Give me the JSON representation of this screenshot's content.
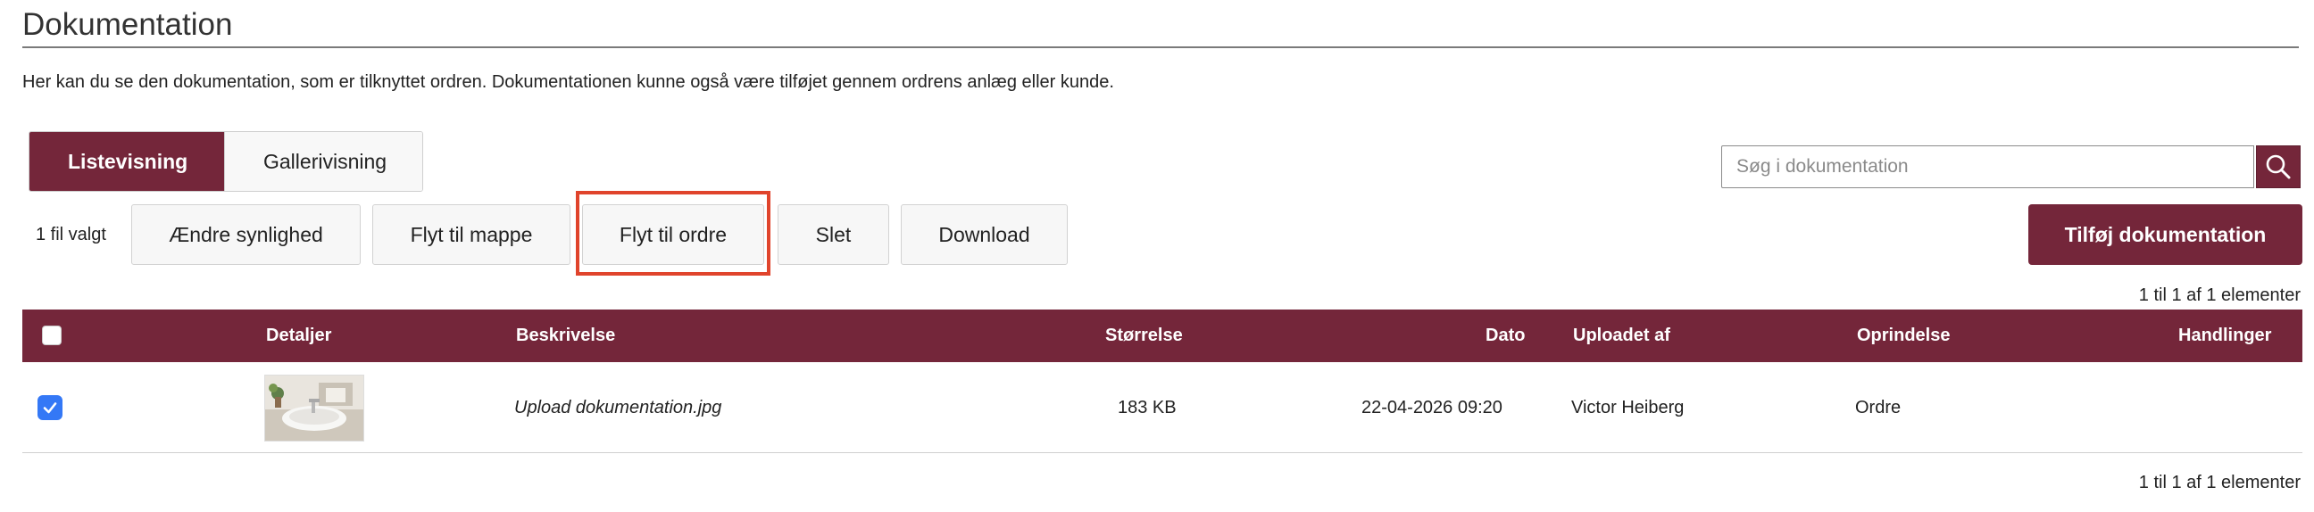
{
  "page": {
    "title": "Dokumentation",
    "intro": "Her kan du se den dokumentation, som er tilknyttet ordren. Dokumentationen kunne også være tilføjet gennem ordrens anlæg eller kunde."
  },
  "view_toggle": {
    "list_label": "Listevisning",
    "gallery_label": "Gallerivisning",
    "active": "list"
  },
  "search": {
    "placeholder": "Søg i dokumentation",
    "value": "",
    "icon": "search-icon"
  },
  "actions": {
    "selected_count": "1 fil valgt",
    "change_visibility": "Ændre synlighed",
    "move_to_folder": "Flyt til mappe",
    "move_to_order": "Flyt til ordre",
    "delete": "Slet",
    "download": "Download",
    "add_documentation": "Tilføj dokumentation"
  },
  "pagination": {
    "top": "1 til 1 af 1 elementer",
    "bottom": "1 til 1 af 1 elementer"
  },
  "table": {
    "columns": {
      "details": "Detaljer",
      "description": "Beskrivelse",
      "size": "Størrelse",
      "date": "Dato",
      "uploaded_by": "Uploadet af",
      "origin": "Oprindelse",
      "actions": "Handlinger"
    },
    "rows": [
      {
        "checked": true,
        "description": "Upload dokumentation.jpg",
        "size": "183 KB",
        "date": "22-04-2026 09:20",
        "uploaded_by": "Victor Heiberg",
        "origin": "Ordre"
      }
    ]
  },
  "colors": {
    "brand": "#74263a",
    "highlight": "#e0442c",
    "checkbox": "#3478f6"
  }
}
